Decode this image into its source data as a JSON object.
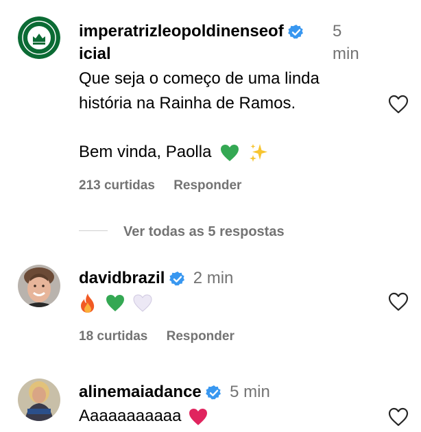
{
  "comments": [
    {
      "username_line1": "imperatrizleopoldinenseof",
      "username_line2": "icial",
      "time_line1": "5",
      "time_line2": "min",
      "text_line1": "Que seja o começo de uma linda",
      "text_line2": "história na Rainha de Ramos.",
      "text_line3": "Bem vinda, Paolla",
      "emojis": [
        "green-heart",
        "sparkles"
      ],
      "likes": "213 curtidas",
      "reply": "Responder",
      "avatar_color": "#0b6b34"
    },
    {
      "username": "davidbrazil",
      "time": "2 min",
      "emojis": [
        "fire",
        "green-heart",
        "white-heart"
      ],
      "likes": "18 curtidas",
      "reply": "Responder"
    },
    {
      "username": "alinemaiadance",
      "time": "5 min",
      "text": "Aaaaaaaaaaa",
      "emojis": [
        "heart"
      ]
    }
  ],
  "view_replies": "Ver todas as 5 respostas",
  "colors": {
    "verified": "#3897f0",
    "muted": "#737373",
    "green_heart": "#34a853",
    "pink_heart": "#e0245e"
  }
}
